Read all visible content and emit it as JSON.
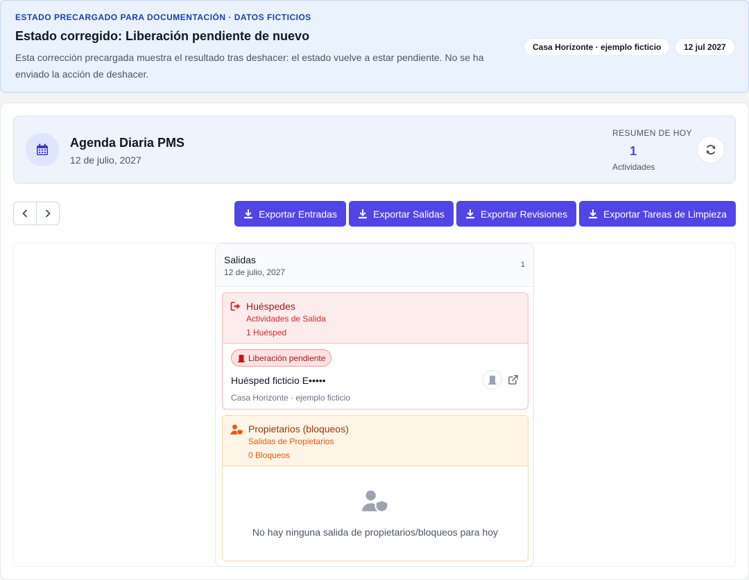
{
  "banner": {
    "kicker": "ESTADO PRECARGADO PARA DOCUMENTACIÓN · DATOS FICTICIOS",
    "title": "Estado corregido: Liberación pendiente de nuevo",
    "description": "Esta corrección precargada muestra el resultado tras deshacer: el estado vuelve a estar pendiente. No se ha enviado la acción de deshacer.",
    "property_pill": "Casa Horizonte · ejemplo ficticio",
    "date_pill": "12 jul 2027"
  },
  "header": {
    "title": "Agenda Diaria PMS",
    "date": "12 de julio, 2027",
    "summary_label": "RESUMEN DE HOY",
    "summary_count": "1",
    "summary_sub": "Actividades",
    "icon": "calendar-icon",
    "refresh_icon": "refresh-icon"
  },
  "toolbar": {
    "prev_icon": "chevron-left-icon",
    "next_icon": "chevron-right-icon",
    "exports": [
      {
        "label": "Exportar Entradas"
      },
      {
        "label": "Exportar Salidas"
      },
      {
        "label": "Exportar Revisiones"
      },
      {
        "label": "Exportar Tareas de Limpieza"
      }
    ]
  },
  "column": {
    "title": "Salidas",
    "date": "12 de julio, 2027",
    "count": "1",
    "guests": {
      "title": "Huéspedes",
      "subtitle": "Actividades de Salida",
      "count": "1 Huésped",
      "item": {
        "status": "Liberación pendiente",
        "name": "Huésped ficticio E•••••",
        "property": "Casa Horizonte · ejemplo ficticio"
      }
    },
    "owners": {
      "title": "Propietarios (bloqueos)",
      "subtitle": "Salidas de Propietarios",
      "count": "0 Bloqueos",
      "empty": "No hay ninguna salida de propietarios/bloqueos para hoy"
    }
  },
  "colors": {
    "accent": "#4f46e5",
    "guests_red": "#dc2626",
    "owners_orange": "#ea580c",
    "banner_blue": "#1e40af"
  }
}
